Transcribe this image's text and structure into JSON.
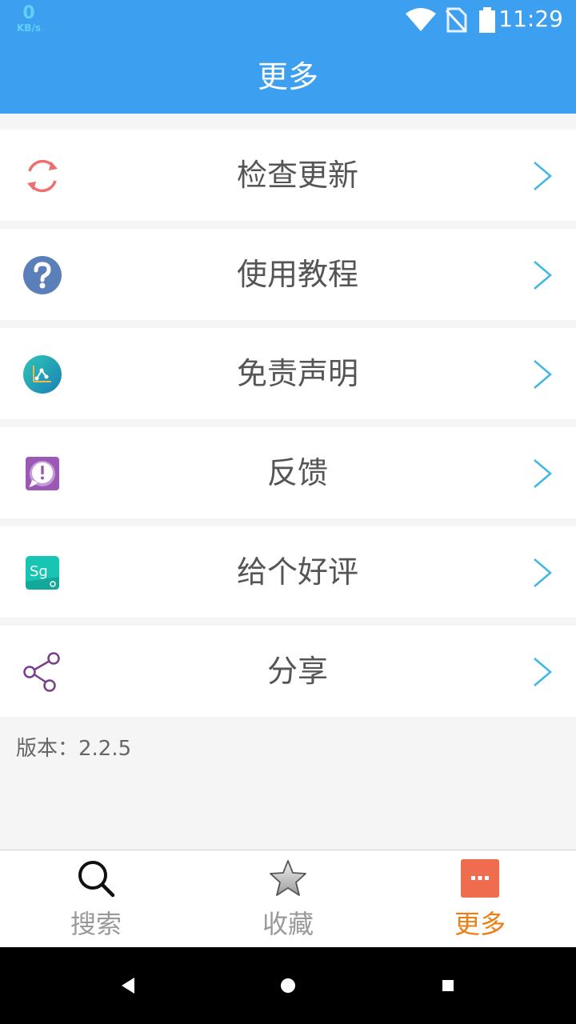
{
  "status_bar": {
    "net_speed": "0",
    "net_unit": "KB/s",
    "time": "11:29",
    "icons": [
      "wifi-icon",
      "no-sim-icon",
      "battery-icon"
    ]
  },
  "header": {
    "title": "更多"
  },
  "menu": {
    "items": [
      {
        "label": "检查更新",
        "icon": "refresh-icon"
      },
      {
        "label": "使用教程",
        "icon": "question-icon"
      },
      {
        "label": "免责声明",
        "icon": "disclaimer-icon"
      },
      {
        "label": "反馈",
        "icon": "feedback-icon"
      },
      {
        "label": "给个好评",
        "icon": "rating-icon"
      },
      {
        "label": "分享",
        "icon": "share-icon"
      }
    ],
    "chevron_icon": "chevron-right-icon"
  },
  "version": {
    "text": "版本：2.2.5"
  },
  "bottom_nav": {
    "tabs": [
      {
        "label": "搜索",
        "icon": "search-icon"
      },
      {
        "label": "收藏",
        "icon": "star-icon"
      },
      {
        "label": "更多",
        "icon": "more-icon"
      }
    ],
    "active_index": 2,
    "active_color": "#ee7d12"
  },
  "colors": {
    "appbar": "#3d9ff0",
    "chevron": "#40b8e6",
    "refresh": "#ee6f6f",
    "question": "#5b7fb8",
    "feedback": "#9b59b6",
    "rating": "#18c4b4",
    "share": "#7a3e8c"
  }
}
